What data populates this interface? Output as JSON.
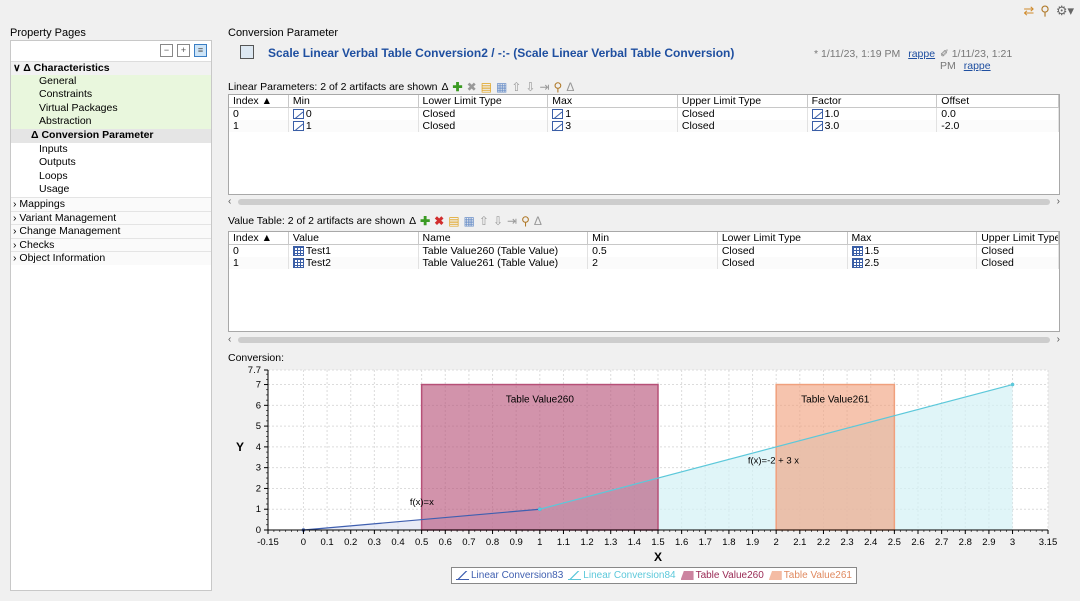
{
  "top_icons": [
    "sync-icon",
    "filter-icon",
    "gear-icon"
  ],
  "left_panel": {
    "title": "Property Pages",
    "items": [
      {
        "label": "Characteristics",
        "type": "group",
        "prefix": "∨ Δ "
      },
      {
        "label": "General",
        "type": "child-green"
      },
      {
        "label": "Constraints",
        "type": "child-green"
      },
      {
        "label": "Virtual Packages",
        "type": "child-green"
      },
      {
        "label": "Abstraction",
        "type": "child-green"
      },
      {
        "label": "Conversion Parameter",
        "type": "selected",
        "prefix": "Δ "
      },
      {
        "label": "Inputs",
        "type": "child"
      },
      {
        "label": "Outputs",
        "type": "child"
      },
      {
        "label": "Loops",
        "type": "child"
      },
      {
        "label": "Usage",
        "type": "child"
      },
      {
        "label": "Mappings",
        "type": "grp",
        "prefix": "› "
      },
      {
        "label": "Variant Management",
        "type": "grp",
        "prefix": "› "
      },
      {
        "label": "Change Management",
        "type": "grp",
        "prefix": "› "
      },
      {
        "label": "Checks",
        "type": "grp",
        "prefix": "› "
      },
      {
        "label": "Object Information",
        "type": "grp",
        "prefix": "› "
      }
    ]
  },
  "right_panel": {
    "title": "Conversion Parameter",
    "doc_title": "Scale Linear Verbal Table Conversion2 / -:- (Scale Linear Verbal Table Conversion)",
    "created": "* 1/11/23, 1:19 PM",
    "created_user": "rappe",
    "modified": "✐ 1/11/23, 1:21 PM",
    "modified_user": "rappe"
  },
  "linear": {
    "label": "Linear Parameters: 2 of 2 artifacts are shown",
    "columns": [
      "Index",
      "Min",
      "Lower Limit Type",
      "Max",
      "Upper Limit Type",
      "Factor",
      "Offset"
    ],
    "rows": [
      [
        "0",
        "0",
        "Closed",
        "1",
        "Closed",
        "1.0",
        "0.0"
      ],
      [
        "1",
        "1",
        "Closed",
        "3",
        "Closed",
        "3.0",
        "-2.0"
      ]
    ]
  },
  "value_table": {
    "label": "Value Table: 2 of 2 artifacts are shown",
    "columns": [
      "Index",
      "Value",
      "Name",
      "Min",
      "Lower Limit Type",
      "Max",
      "Upper Limit Type"
    ],
    "rows": [
      [
        "0",
        "Test1",
        "Table Value260 (Table Value)",
        "0.5",
        "Closed",
        "1.5",
        "Closed"
      ],
      [
        "1",
        "Test2",
        "Table Value261 (Table Value)",
        "2",
        "Closed",
        "2.5",
        "Closed"
      ]
    ]
  },
  "conversion_label": "Conversion:",
  "chart_data": {
    "type": "line",
    "xlabel": "X",
    "ylabel": "Y",
    "xlim": [
      -0.15,
      3.15
    ],
    "ylim": [
      0,
      7.7
    ],
    "xticks": [
      -0.15,
      0,
      0.1,
      0.2,
      0.3,
      0.4,
      0.5,
      0.6,
      0.7,
      0.8,
      0.9,
      1,
      1.1,
      1.2,
      1.3,
      1.4,
      1.5,
      1.6,
      1.7,
      1.8,
      1.9,
      2,
      2.1,
      2.2,
      2.3,
      2.4,
      2.5,
      2.6,
      2.7,
      2.8,
      2.9,
      3,
      3.15
    ],
    "yticks": [
      0,
      1,
      2,
      3,
      4,
      5,
      6,
      7,
      7.7
    ],
    "grid": true,
    "series": [
      {
        "name": "Linear Conversion83",
        "color": "#3f5fb0",
        "x": [
          0,
          1
        ],
        "y": [
          0,
          1
        ],
        "formula": "f(x)=x"
      },
      {
        "name": "Linear Conversion84",
        "color": "#5cc8da",
        "x": [
          1,
          3
        ],
        "y": [
          1,
          7
        ],
        "formula": "f(x)=-2 + 3 x"
      }
    ],
    "regions": [
      {
        "name": "Table Value260",
        "color": "#b65077",
        "x": [
          0.5,
          1.5
        ],
        "y_top": 7
      },
      {
        "name": "Table Value261",
        "color": "#f0a07d",
        "x": [
          2,
          2.5
        ],
        "y_top": 7
      }
    ],
    "legend": [
      "Linear Conversion83",
      "Linear Conversion84",
      "Table Value260",
      "Table Value261"
    ],
    "legend_position": "bottom"
  }
}
